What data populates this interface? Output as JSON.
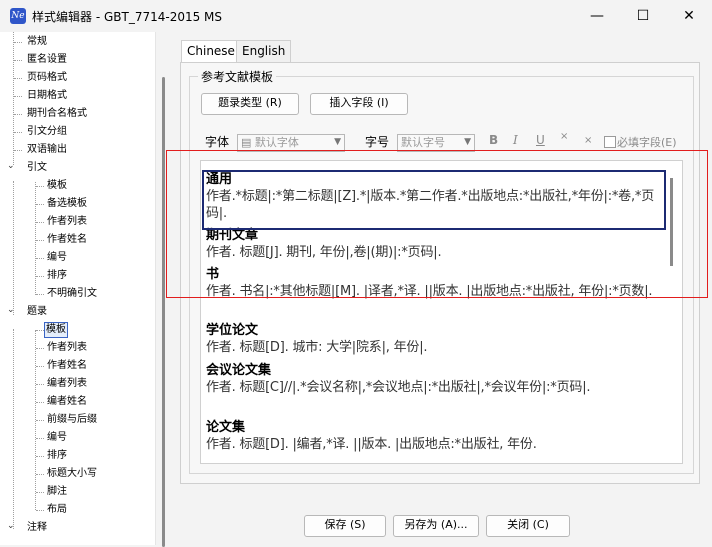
{
  "window": {
    "title": "样式编辑器 - GBT_7714-2015 MS",
    "app_icon": "Ne",
    "minimize": "—",
    "maximize": "☐",
    "close": "✕"
  },
  "tree": {
    "top_items": [
      "常规",
      "匿名设置",
      "页码格式",
      "日期格式",
      "期刊合名格式",
      "引文分组",
      "双语输出"
    ],
    "citation": {
      "label": "引文",
      "children": [
        "模板",
        "备选模板",
        "作者列表",
        "作者姓名",
        "编号",
        "排序",
        "不明确引文"
      ]
    },
    "bibliography": {
      "label": "题录",
      "children": [
        "模板",
        "作者列表",
        "作者姓名",
        "编者列表",
        "编者姓名",
        "前缀与后缀",
        "编号",
        "排序",
        "标题大小写",
        "脚注",
        "布局"
      ]
    },
    "footnote": {
      "label": "注释"
    },
    "selected": "模板"
  },
  "tabs": [
    "Chinese",
    "English"
  ],
  "group_label": "参考文献模板",
  "buttons": {
    "ref_type": "题录类型 (R)",
    "insert_field": "插入字段 (I)",
    "save": "保存 (S)",
    "save_as": "另存为 (A)...",
    "close": "关闭 (C)"
  },
  "font": {
    "label": "字体",
    "value": "默认字体"
  },
  "size": {
    "label": "字号",
    "value": "默认字号"
  },
  "format_icons": [
    "B",
    "I",
    "U",
    "×",
    "×"
  ],
  "required_field": "必填字段(E)",
  "styles": [
    {
      "name": "通用",
      "content": "作者.*标题|:*第二标题|[Z].*|版本.*第二作者.*出版地点:*出版社,*年份|:*卷,*页码|."
    },
    {
      "name": "期刊文章",
      "content": "作者. 标题[J]. 期刊, 年份|,卷|(期)|:*页码|."
    },
    {
      "name": "书",
      "content": "作者. 书名|:*其他标题|[M]. |译者,*译. ||版本. |出版地点:*出版社, 年份|:*页数|."
    },
    {
      "name": "学位论文",
      "content": "作者. 标题[D]. 城市: 大学|院系|, 年份|."
    },
    {
      "name": "会议论文集",
      "content": "作者. 标题[C]//|.*会议名称|,*会议地点|:*出版社|,*会议年份|:*页码|."
    },
    {
      "name": "论文集",
      "content": "作者. 标题[D]. |编者,*译. ||版本. |出版地点:*出版社, 年份."
    }
  ]
}
